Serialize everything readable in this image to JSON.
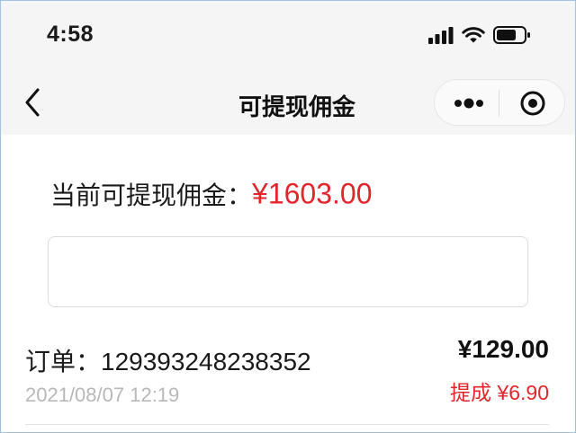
{
  "status_bar": {
    "time": "4:58",
    "icons": [
      "signal-icon",
      "wifi-icon",
      "battery-icon"
    ]
  },
  "nav": {
    "title": "可提现佣金",
    "icons": [
      "back-chevron-icon",
      "more-dots-icon",
      "target-icon"
    ]
  },
  "balance": {
    "label": "当前可提现佣金：",
    "amount": "¥1603.00"
  },
  "withdraw_input": {
    "value": "",
    "placeholder": ""
  },
  "orders": [
    {
      "order_number": "订单：129393248238352",
      "date": "2021/08/07 12:19",
      "total": "¥129.00",
      "commission": "提成 ¥6.90"
    }
  ],
  "colors": {
    "accent_red": "#e2252b",
    "navbar_bg": "#f5f5f5",
    "muted_text": "#b8b8b8"
  }
}
